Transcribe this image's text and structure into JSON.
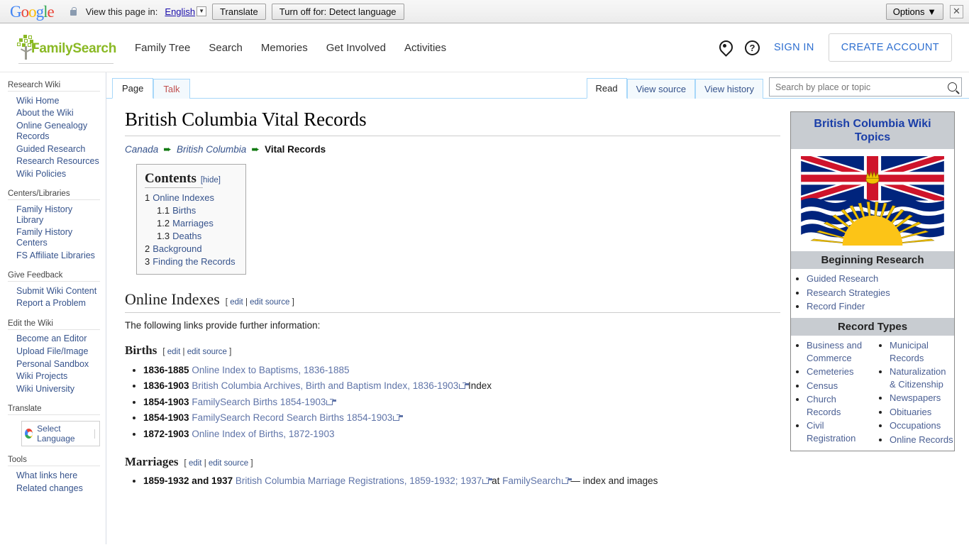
{
  "translate_bar": {
    "logo": "Google",
    "lock_icon": "lock-icon",
    "view_label": "View this page in:",
    "language": "English",
    "translate_button": "Translate",
    "turnoff_button": "Turn off for: Detect language",
    "options_button": "Options ▼",
    "close_icon": "✕"
  },
  "header": {
    "brand": "FamilySearch",
    "nav": [
      {
        "label": "Family Tree"
      },
      {
        "label": "Search"
      },
      {
        "label": "Memories"
      },
      {
        "label": "Get Involved"
      },
      {
        "label": "Activities"
      }
    ],
    "sign_in": "SIGN IN",
    "create_account": "CREATE ACCOUNT",
    "brand_color": "#8ab924"
  },
  "sidebar": {
    "groups": [
      {
        "heading": "Research Wiki",
        "items": [
          "Wiki Home",
          "About the Wiki",
          "Online Genealogy Records",
          "Guided Research",
          "Research Resources",
          "Wiki Policies"
        ]
      },
      {
        "heading": "Centers/Libraries",
        "items": [
          "Family History Library",
          "Family History Centers",
          "FS Affiliate Libraries"
        ]
      },
      {
        "heading": "Give Feedback",
        "items": [
          "Submit Wiki Content",
          "Report a Problem"
        ]
      },
      {
        "heading": "Edit the Wiki",
        "items": [
          "Become an Editor",
          "Upload File/Image",
          "Personal Sandbox",
          "Wiki Projects",
          "Wiki University"
        ]
      }
    ],
    "translate_heading": "Translate",
    "select_language": "Select Language",
    "tools_heading": "Tools",
    "tools_items": [
      "What links here",
      "Related changes"
    ]
  },
  "tabs": {
    "left": [
      {
        "label": "Page",
        "active": true
      },
      {
        "label": "Talk",
        "active": false
      }
    ],
    "right": [
      {
        "label": "Read",
        "active": true
      },
      {
        "label": "View source",
        "active": false
      },
      {
        "label": "View history",
        "active": false
      }
    ],
    "search_placeholder": "Search by place or topic",
    "search_value": "",
    "search_icon": "search-icon"
  },
  "article": {
    "title": "British Columbia Vital Records",
    "breadcrumb": [
      {
        "label": "Canada",
        "link": true
      },
      {
        "label": "British Columbia",
        "link": true
      },
      {
        "label": "Vital Records",
        "link": false
      }
    ],
    "toc": {
      "title": "Contents",
      "hide": "[hide]",
      "entries": [
        {
          "num": "1",
          "label": "Online Indexes",
          "sub": false
        },
        {
          "num": "1.1",
          "label": "Births",
          "sub": true
        },
        {
          "num": "1.2",
          "label": "Marriages",
          "sub": true
        },
        {
          "num": "1.3",
          "label": "Deaths",
          "sub": true
        },
        {
          "num": "2",
          "label": "Background",
          "sub": false
        },
        {
          "num": "3",
          "label": "Finding the Records",
          "sub": false
        }
      ]
    },
    "edit_open": "[",
    "edit": "edit",
    "edit_sep": "|",
    "edit_source": "edit source",
    "edit_close": "]",
    "section_online_indexes": "Online Indexes",
    "lead": "The following links provide further information:",
    "section_births": "Births",
    "births": [
      {
        "years": "1836-1885",
        "text": "Online Index to Baptisms, 1836-1885",
        "external": false,
        "suffix": ""
      },
      {
        "years": "1836-1903",
        "text": "British Columbia Archives, Birth and Baptism Index, 1836-1903",
        "external": true,
        "suffix": " Index"
      },
      {
        "years": "1854-1903",
        "text": "FamilySearch Births 1854-1903",
        "external": true,
        "suffix": ""
      },
      {
        "years": "1854-1903",
        "text": "FamilySearch Record Search Births 1854-1903",
        "external": true,
        "suffix": ""
      },
      {
        "years": "1872-1903",
        "text": "Online Index of Births, 1872-1903",
        "external": false,
        "suffix": ""
      }
    ],
    "section_marriages": "Marriages",
    "marriages": [
      {
        "years": "1859-1932 and 1937",
        "text": "British Columbia Marriage Registrations, 1859-1932; 1937",
        "external": true,
        "mid": " at ",
        "link2": "FamilySearch",
        "suffix": " — index and images"
      }
    ]
  },
  "infobox": {
    "title": "British Columbia Wiki Topics",
    "flag_alt": "british-columbia-flag",
    "beginning_research_heading": "Beginning Research",
    "beginning_research": [
      "Guided Research",
      "Research Strategies",
      "Record Finder"
    ],
    "record_types_heading": "Record Types",
    "record_types_col1": [
      "Business and Commerce",
      "Cemeteries",
      "Census",
      "Church Records",
      "Civil Registration"
    ],
    "record_types_col2": [
      "Municipal Records",
      "Naturalization & Citizenship",
      "Newspapers",
      "Obituaries",
      "Occupations",
      "Online Records"
    ]
  }
}
